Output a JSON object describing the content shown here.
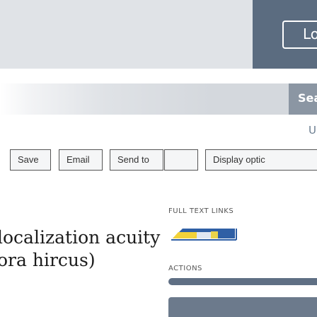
{
  "header": {
    "login_label": "Lo"
  },
  "search": {
    "button_label": "Sea"
  },
  "util": {
    "link_label": "U"
  },
  "toolbar": {
    "buttons": [
      {
        "label": "Save"
      },
      {
        "label": "Email"
      },
      {
        "label": "Send to"
      },
      {
        "label": ""
      },
      {
        "label": "Display optic"
      }
    ]
  },
  "record": {
    "title_line1": "localization acuity",
    "title_line2": "ora hircus)"
  },
  "sidebar": {
    "full_text_label": "FULL TEXT LINKS",
    "actions_label": "ACTIONS"
  },
  "colors": {
    "header_bg": "#e0e3e7",
    "header_dark": "#5b6c80",
    "search_btn": "#8b96a3",
    "actions_button": "#5f6f84"
  }
}
